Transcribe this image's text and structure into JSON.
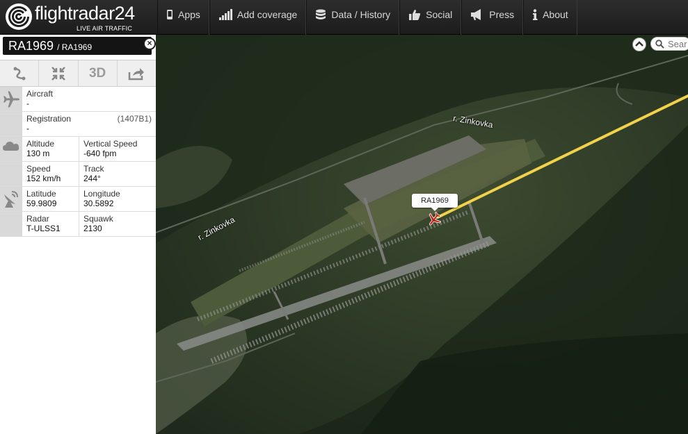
{
  "logo": {
    "name": "flightradar24",
    "tagline": "LIVE AIR TRAFFIC"
  },
  "nav": [
    {
      "label": "Apps",
      "icon": "phone-icon"
    },
    {
      "label": "Add coverage",
      "icon": "signal-bars-icon"
    },
    {
      "label": "Data / History",
      "icon": "database-icon"
    },
    {
      "label": "Social",
      "icon": "thumbs-up-icon"
    },
    {
      "label": "Press",
      "icon": "megaphone-icon"
    },
    {
      "label": "About",
      "icon": "info-icon"
    }
  ],
  "flight": {
    "callsign": "RA1969",
    "sub": "/ RA1969",
    "close_label": "×",
    "actions": {
      "route_icon": "route-icon",
      "minimize_icon": "collapse-arrows-icon",
      "three_d": "3D",
      "share_icon": "share-icon"
    },
    "aircraft": {
      "label": "Aircraft",
      "value": "-"
    },
    "registration": {
      "label": "Registration",
      "value": "-",
      "hex": "(1407B1)"
    },
    "altitude": {
      "label": "Altitude",
      "value": "130 m"
    },
    "vertical_speed": {
      "label": "Vertical Speed",
      "value": "-640 fpm"
    },
    "speed": {
      "label": "Speed",
      "value": "152 km/h"
    },
    "track": {
      "label": "Track",
      "value": "244°"
    },
    "latitude": {
      "label": "Latitude",
      "value": "59.9809"
    },
    "longitude": {
      "label": "Longitude",
      "value": "30.5892"
    },
    "radar": {
      "label": "Radar",
      "value": "T-ULSS1"
    },
    "squawk": {
      "label": "Squawk",
      "value": "2130"
    }
  },
  "map": {
    "search_placeholder": "Sear",
    "plane_label": "RA1969",
    "river_labels": [
      "r. Zinkovka",
      "r. Zinkovka"
    ],
    "colors": {
      "track": "#f2d24a",
      "plane": "#c0281c"
    }
  }
}
